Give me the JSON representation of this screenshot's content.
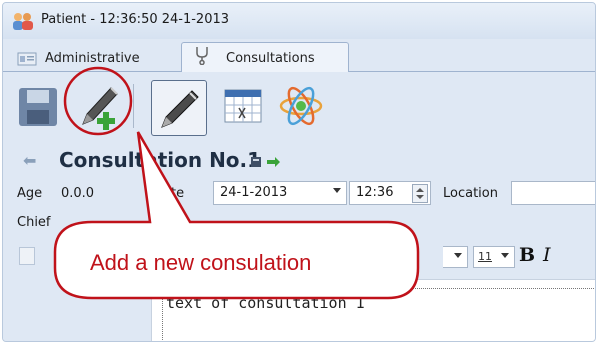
{
  "window": {
    "title": "Patient - 12:36:50 24-1-2013",
    "icon": "patient-group-icon"
  },
  "tabs": [
    {
      "label": "Administrative",
      "icon": "admin-card-icon",
      "active": false
    },
    {
      "label": "Consultations",
      "icon": "stethoscope-icon",
      "active": true
    }
  ],
  "toolbar": {
    "buttons": [
      {
        "name": "save-button",
        "icon": "floppy-disk-icon"
      },
      {
        "name": "new-consultation-button",
        "icon": "pen-add-icon"
      },
      {
        "name": "edit-consultation-button",
        "icon": "pen-icon"
      },
      {
        "name": "calendar-button",
        "icon": "calendar-grid-icon"
      },
      {
        "name": "atom-button",
        "icon": "atom-icon"
      }
    ]
  },
  "consultation": {
    "title": "Consultation No.1"
  },
  "fields": {
    "age_label": "Age",
    "age_value": "0.0.0",
    "date_label": "Date",
    "date_value": "24-1-2013",
    "time_value": "12:36",
    "location_label": "Location",
    "chief_label": "Chief"
  },
  "format_bar": {
    "font_size": "11",
    "bold": "B",
    "italic": "I"
  },
  "editor": {
    "text": "text of consultation 1"
  },
  "callout": {
    "text": "Add a new consulation"
  },
  "colors": {
    "callout_red": "#c0121a",
    "background": "#dfe8f4",
    "accent_blue": "#9fb3cf"
  }
}
